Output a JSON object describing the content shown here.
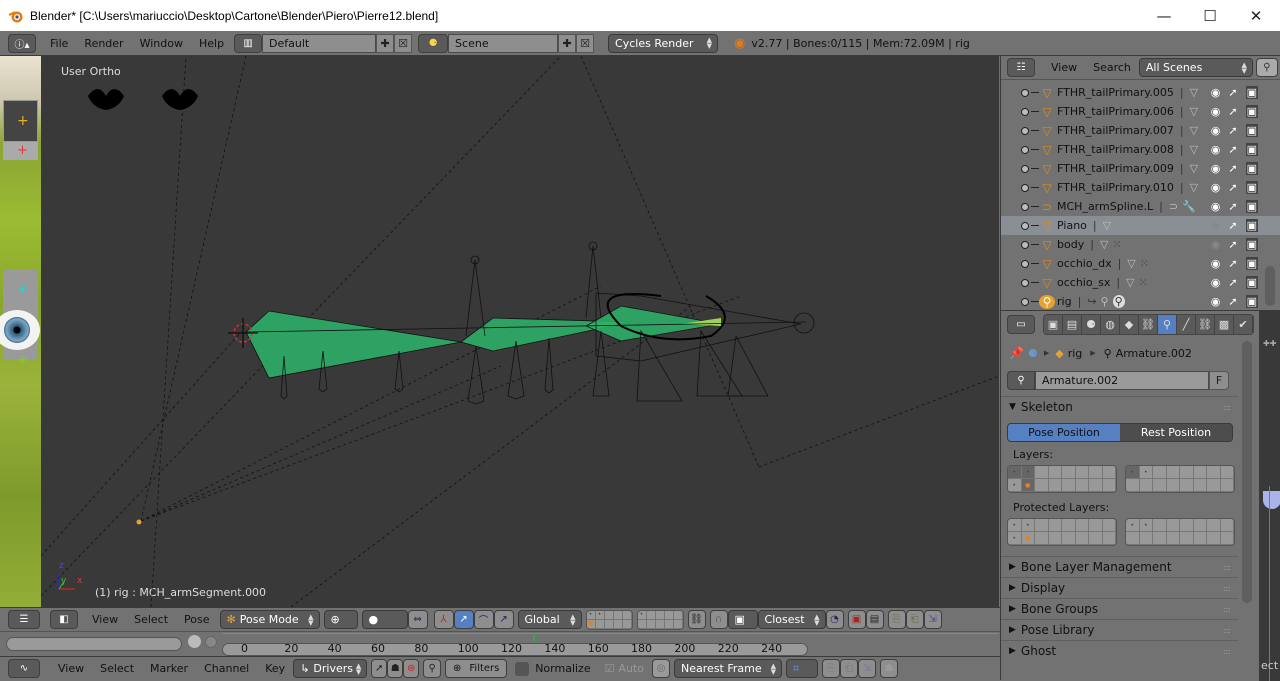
{
  "window": {
    "title": "Blender* [C:\\Users\\mariuccio\\Desktop\\Cartone\\Blender\\Piero\\Pierre12.blend]",
    "controls": {
      "minimize": "—",
      "maximize": "☐",
      "close": "✕"
    }
  },
  "infobar": {
    "menus": [
      "File",
      "Render",
      "Window",
      "Help"
    ],
    "layout": "Default",
    "scene": "Scene",
    "render_engine": "Cycles Render",
    "stats": "v2.77 | Bones:0/115  | Mem:72.09M | rig"
  },
  "viewport": {
    "view_label": "User Ortho",
    "active_info": "(1) rig : MCH_armSegment.000",
    "axis": {
      "z": "z",
      "y": "y",
      "x": "x"
    }
  },
  "view3d_header": {
    "menus": [
      "View",
      "Select",
      "Pose"
    ],
    "mode": "Pose Mode",
    "orientation": "Global",
    "snap_target": "Closest"
  },
  "timeline": {
    "ticks": [
      "0",
      "20",
      "40",
      "60",
      "80",
      "100",
      "120",
      "140",
      "160",
      "180",
      "200",
      "220",
      "240"
    ],
    "current_frame_marker": 133
  },
  "graph_header": {
    "menus": [
      "View",
      "Select",
      "Marker",
      "Channel",
      "Key"
    ],
    "mode": "Drivers",
    "filters_label": "Filters",
    "normalize_label": "Normalize",
    "auto_label": "Auto",
    "snap": "Nearest Frame"
  },
  "outliner": {
    "menus": [
      "View",
      "Search"
    ],
    "filter": "All Scenes",
    "rows": [
      {
        "name": "FTHR_tailPrimary.005",
        "type": "mesh",
        "visible": true,
        "extras": "mesh"
      },
      {
        "name": "FTHR_tailPrimary.006",
        "type": "mesh",
        "visible": true,
        "extras": "mesh"
      },
      {
        "name": "FTHR_tailPrimary.007",
        "type": "mesh",
        "visible": true,
        "extras": "mesh"
      },
      {
        "name": "FTHR_tailPrimary.008",
        "type": "mesh",
        "visible": true,
        "extras": "mesh"
      },
      {
        "name": "FTHR_tailPrimary.009",
        "type": "mesh",
        "visible": true,
        "extras": "mesh"
      },
      {
        "name": "FTHR_tailPrimary.010",
        "type": "mesh",
        "visible": true,
        "extras": "mesh"
      },
      {
        "name": "MCH_armSpline.L",
        "type": "curve",
        "visible": true,
        "extras": "curve-modifier"
      },
      {
        "name": "Piano",
        "type": "mesh",
        "visible": false,
        "extras": "mesh",
        "selected": true
      },
      {
        "name": "body",
        "type": "mesh",
        "visible": false,
        "extras": "mesh-groups"
      },
      {
        "name": "occhio_dx",
        "type": "mesh",
        "visible": true,
        "extras": "mesh-groups"
      },
      {
        "name": "occhio_sx",
        "type": "mesh",
        "visible": true,
        "extras": "mesh-groups"
      },
      {
        "name": "rig",
        "type": "armature",
        "visible": true,
        "extras": "armature"
      }
    ]
  },
  "properties": {
    "tabs": [
      "render",
      "render-layers",
      "scene",
      "world",
      "object",
      "constraints",
      "data",
      "bone",
      "bone-constraints",
      "texture",
      "modifier"
    ],
    "active_tab": "data",
    "breadcrumb": {
      "object": "rig",
      "data": "Armature.002"
    },
    "datablock": "Armature.002",
    "fake_user": "F",
    "skeleton": {
      "title": "Skeleton",
      "pose_position": "Pose Position",
      "rest_position": "Rest Position",
      "layers_label": "Layers:",
      "protected_label": "Protected Layers:"
    },
    "panels": [
      "Bone Layer Management",
      "Display",
      "Bone Groups",
      "Pose Library",
      "Ghost"
    ],
    "side_text": "ect"
  }
}
